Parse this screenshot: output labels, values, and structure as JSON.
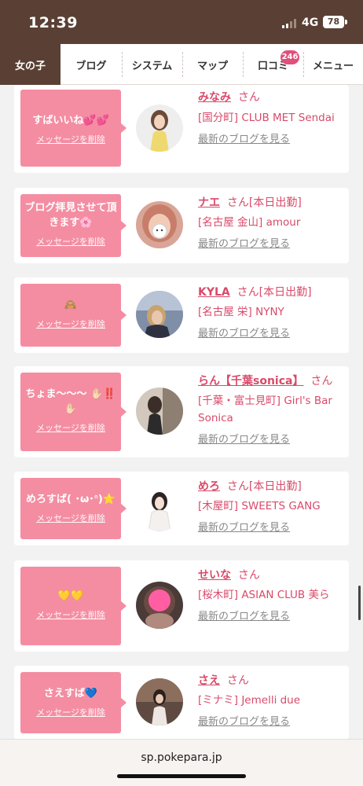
{
  "status": {
    "time": "12:39",
    "network": "4G",
    "battery": "78"
  },
  "nav": {
    "tabs": [
      "女の子",
      "ブログ",
      "システム",
      "マップ",
      "口コミ",
      "メニュー"
    ],
    "active_index": 0,
    "review_badge": "246"
  },
  "labels": {
    "san": "さん",
    "delete": "メッセージを削除",
    "blog": "最新のブログを見る"
  },
  "cards": [
    {
      "message": "すばいいね💕💕",
      "name": "みなみ",
      "status": "",
      "shop": "[国分町] CLUB MET Sendai"
    },
    {
      "message": "ブログ拝見させて頂きます🌸",
      "name": "ナエ",
      "status": "[本日出勤]",
      "shop": "[名古屋 金山] amour"
    },
    {
      "message": "🙈",
      "name": "KYLA",
      "status": "[本日出勤]",
      "shop": "[名古屋 栄] NYNY"
    },
    {
      "message": "ちょま〜〜〜 ✋🏻‼️✋🏻",
      "name": "らん【千葉sonica】",
      "status": "",
      "shop": "[千葉・富士見町] Girl's Bar Sonica"
    },
    {
      "message": "めろすば( ･ω･ᐢ)⭐",
      "name": "めろ",
      "status": "[本日出勤]",
      "shop": "[木屋町] SWEETS GANG"
    },
    {
      "message": "💛💛",
      "name": "せいな",
      "status": "",
      "shop": "[桜木町] ASIAN CLUB 美ら"
    },
    {
      "message": "さえすば💙",
      "name": "さえ",
      "status": "",
      "shop": "[ミナミ] Jemelli due"
    }
  ],
  "url": "sp.pokepara.jp",
  "colors": {
    "header": "#5a4034",
    "bubble": "#f48da2",
    "link": "#d94a6a",
    "badge": "#e0507a"
  }
}
